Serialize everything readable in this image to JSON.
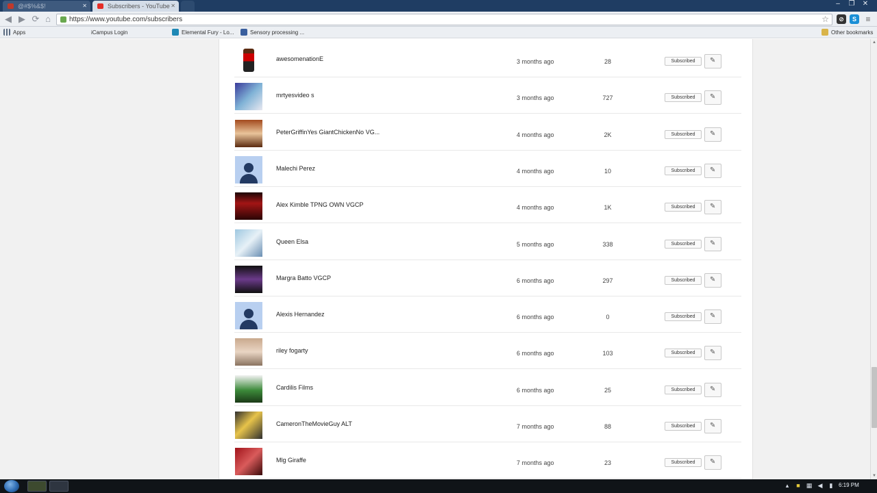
{
  "browser": {
    "tabs": [
      {
        "label": "@#$%&$!",
        "active": false
      },
      {
        "label": "Subscribers - YouTube",
        "active": true
      }
    ],
    "url": "https://www.youtube.com/subscribers",
    "window_controls": {
      "minimize": "–",
      "restore": "❐",
      "close": "✕"
    },
    "bookmarks": [
      {
        "label": "Apps",
        "icon": "apps-grid-icon"
      },
      {
        "label": "iCampus Login",
        "icon": "icampus-icon"
      },
      {
        "label": "Elemental Fury - Lo...",
        "icon": "elemental-icon"
      },
      {
        "label": "Sensory processing ...",
        "icon": "sensory-icon"
      },
      {
        "label": "Other bookmarks",
        "icon": "folder-icon"
      }
    ]
  },
  "subscribers": [
    {
      "name": "awesomenationE",
      "when": "3 months ago",
      "count": "28",
      "button": "Subscribed",
      "avatar": "avatar-roblox"
    },
    {
      "name": "mrtyesvideo s",
      "when": "3 months ago",
      "count": "727",
      "button": "Subscribed",
      "avatar": "avatar-blue-art"
    },
    {
      "name": "PeterGriffinYes GiantChickenNo VG...",
      "when": "4 months ago",
      "count": "2K",
      "button": "Subscribed",
      "avatar": "avatar-anime"
    },
    {
      "name": "Malechi Perez",
      "when": "4 months ago",
      "count": "10",
      "button": "Subscribed",
      "avatar": "avatar-default"
    },
    {
      "name": "Alex Kimble TPNG OWN VGCP",
      "when": "4 months ago",
      "count": "1K",
      "button": "Subscribed",
      "avatar": "avatar-red-text"
    },
    {
      "name": "Queen Elsa",
      "when": "5 months ago",
      "count": "338",
      "button": "Subscribed",
      "avatar": "avatar-elsa"
    },
    {
      "name": "Margra Batto VGCP",
      "when": "6 months ago",
      "count": "297",
      "button": "Subscribed",
      "avatar": "avatar-character"
    },
    {
      "name": "Alexis Hernandez",
      "when": "6 months ago",
      "count": "0",
      "button": "Subscribed",
      "avatar": "avatar-default"
    },
    {
      "name": "riley fogarty",
      "when": "6 months ago",
      "count": "103",
      "button": "Subscribed",
      "avatar": "avatar-photo"
    },
    {
      "name": "Cardilis Films",
      "when": "6 months ago",
      "count": "25",
      "button": "Subscribed",
      "avatar": "avatar-green-creature"
    },
    {
      "name": "CameronTheMovieGuy ALT",
      "when": "7 months ago",
      "count": "88",
      "button": "Subscribed",
      "avatar": "avatar-cartoon"
    },
    {
      "name": "Mlg Giraffe",
      "when": "7 months ago",
      "count": "23",
      "button": "Subscribed",
      "avatar": "avatar-red-creature"
    }
  ],
  "taskbar": {
    "time": "6:19 PM"
  }
}
